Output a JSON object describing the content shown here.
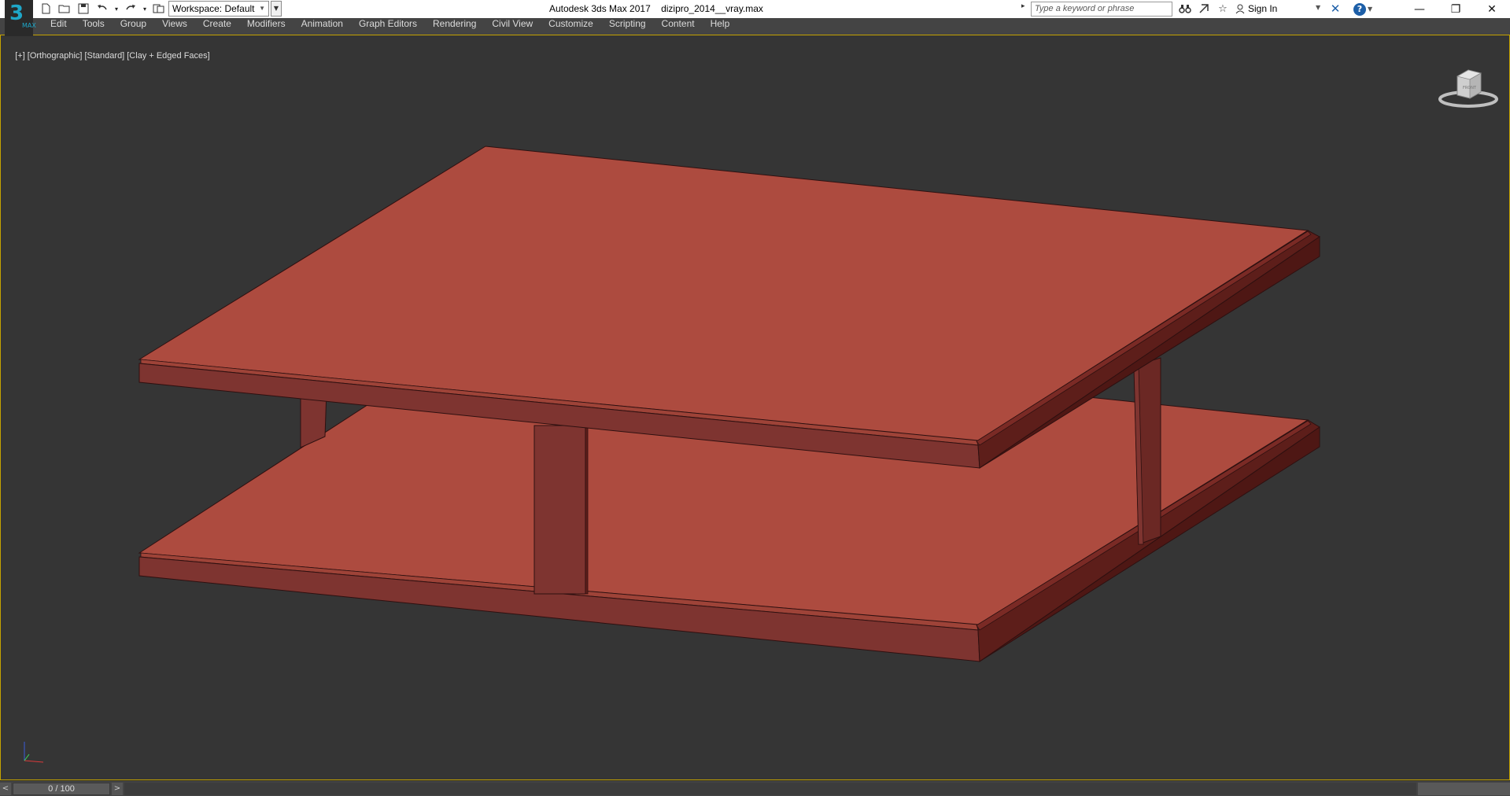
{
  "app": {
    "logo_text": "3",
    "logo_sub": "MAX",
    "title": "Autodesk 3ds Max 2017    dizipro_2014__vray.max"
  },
  "quick_access": {
    "icons": [
      "new-file-icon",
      "open-file-icon",
      "save-icon",
      "undo-icon",
      "redo-icon",
      "project-folder-icon"
    ],
    "workspace_label": "Workspace: Default"
  },
  "search": {
    "placeholder": "Type a keyword or phrase"
  },
  "account": {
    "signin_label": "Sign In"
  },
  "window_controls": {
    "minimize": "—",
    "restore": "❐",
    "close": "✕"
  },
  "menu": {
    "items": [
      "Edit",
      "Tools",
      "Group",
      "Views",
      "Create",
      "Modifiers",
      "Animation",
      "Graph Editors",
      "Rendering",
      "Civil View",
      "Customize",
      "Scripting",
      "Content",
      "Help"
    ]
  },
  "viewport": {
    "label_plus": "[+]",
    "label_view": "[Orthographic]",
    "label_shading_std": "[Standard]",
    "label_shading_mode": "[Clay + Edged Faces]",
    "viewcube_face": "FRONT",
    "object_color": "#ad4b3f",
    "background_color": "#353535"
  },
  "timeline": {
    "prev": "<",
    "frame_text": "0 / 100",
    "next": ">"
  }
}
